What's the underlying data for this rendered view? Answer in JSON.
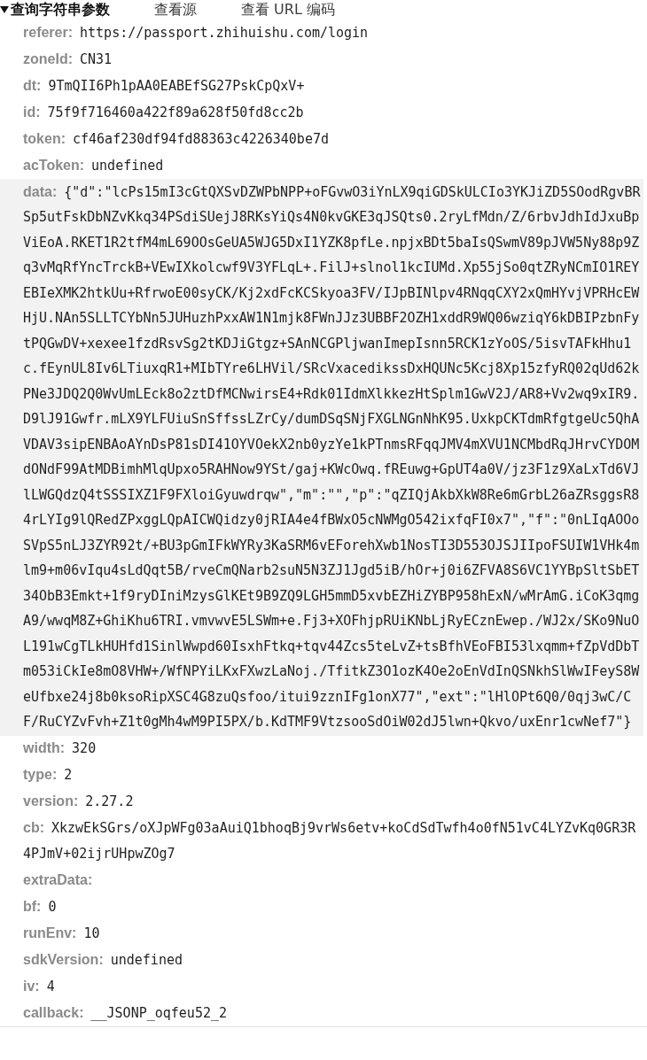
{
  "section": {
    "title": "查询字符串参数",
    "expanded": true,
    "actions": [
      "查看源",
      "查看 URL 编码"
    ]
  },
  "params": [
    {
      "name": "referer:",
      "value": "https://passport.zhihuishu.com/login",
      "selected": false
    },
    {
      "name": "zoneId:",
      "value": "CN31",
      "selected": false
    },
    {
      "name": "dt:",
      "value": "9TmQII6Ph1pAA0EABEfSG27PskCpQxV+",
      "selected": false
    },
    {
      "name": "id:",
      "value": "75f9f716460a422f89a628f50fd8cc2b",
      "selected": false
    },
    {
      "name": "token:",
      "value": "cf46af230df94fd88363c4226340be7d",
      "selected": false
    },
    {
      "name": "acToken:",
      "value": "undefined",
      "selected": false
    },
    {
      "name": "data:",
      "value": "{\"d\":\"lcPs15mI3cGtQXSvDZWPbNPP+oFGvwO3iYnLX9qiGDSkULCIo3YKJiZD5SOodRgvBRSp5utFskDbNZvKkq34PSdiSUejJ8RKsYiQs4N0kvGKE3qJSQts0.2ryLfMdn/Z/6rbvJdhIdJxuBpViEoA.RKET1R2tfM4mL69OOsGeUA5WJG5DxI1YZK8pfLe.npjxBDt5baIsQSwmV89pJVW5Ny88p9Zq3vMqRfYncTrckB+VEwIXkolcwf9V3YFLqL+.FilJ+slnol1kcIUMd.Xp55jSo0qtZRyNCmIO1REYEBIeXMK2htkUu+RfrwoE00syCK/Kj2xdFcKCSkyoa3FV/IJpBINlpv4RNqqCXY2xQmHYvjVPRHcEWHjU.NAn5SLLTCYbNn5JUHuzhPxxAW1N1mjk8FWnJJz3UBBF2OZH1xddR9WQ06wziqY6kDBIPzbnFytPQGwDV+xexee1fzdRsvSg2tKDJiGtgz+SAnNCGPljwanImepIsnn5RCK1zYoOS/5isvTAFkHhu1c.fEynUL8Iv6LTiuxqR1+MIbTYre6LHVil/SRcVxacedikssDxHQUNc5Kcj8Xp15zfyRQ02qUd62kPNe3JDQ2Q0WvUmLEck8o2ztDfMCNwirsE4+Rdk01IdmXlkkezHtSplm1GwV2J/AR8+Vv2wq9xIR9.D9lJ91Gwfr.mLX9YLFUiuSnSffssLZrCy/dumDSqSNjFXGLNGnNhK95.UxkpCKTdmRfgtgeUc5QhAVDAV3sipENBAoAYnDsP81sDI41OYVOekX2nb0yzYe1kPTnmsRFqqJMV4mXVU1NCMbdRqJHrvCYDOMdONdF99AtMDBimhMlqUpxo5RAHNow9YSt/gaj+KWcOwq.fREuwg+GpUT4a0V/jz3F1z9XaLxTd6VJlLWGQdzQ4tSSSIXZ1F9FXloiGyuwdrqw\",\"m\":\"\",\"p\":\"qZIQjAkbXkW8Re6mGrbL26aZRsggsR84rLYIg9lQRedZPxggLQpAICWQidzy0jRIA4e4fBWxO5cNWMgO542ixfqFI0x7\",\"f\":\"0nLIqAOOoSVpS5nLJ3ZYR92t/+BU3pGmIFkWYRy3KaSRM6vEForehXwb1NosTI3D553OJSJIIpoFSUIW1VHk4mlm9+m06vIqu4sLdQqt5B/rveCmQNarb2suN5N3ZJ1Jgd5iB/hOr+j0i6ZFVA8S6VC1YYBpSltSbET34ObB3Emkt+1f9ryDIniMzysGlKEt9B9ZQ9LGH5mmD5xvbEZHiZYBP958hExN/wMrAmG.iCoK3qmgA9/wwqM8Z+GhiKhu6TRI.vmvwvE5LSWm+e.Fj3+XOFhjpRUiKNbLjRyECznEwep./WJ2x/SKo9NuOL191wCgTLkHUHfd1SinlWwpd60IsxhFtkq+tqv44Zcs5teLvZ+tsBfhVEoFBI53lxqmm+fZpVdDbTm053iCkIe8mO8VHW+/WfNPYiLKxFXwzLaNoj./TfitkZ3O1ozK4Oe2oEnVdInQSNkhSlWwIFeyS8WeUfbxe24j8b0ksoRipXSC4G8zuQsfoo/itui9zznIFg1onX77\",\"ext\":\"lHlOPt6Q0/0qj3wC/CF/RuCYZvFvh+Z1t0gMh4wM9PI5PX/b.KdTMF9VtzsooSdOiW02dJ5lwn+Qkvo/uxEnr1cwNef7\"}",
      "selected": true
    },
    {
      "name": "width:",
      "value": "320",
      "selected": false
    },
    {
      "name": "type:",
      "value": "2",
      "selected": false
    },
    {
      "name": "version:",
      "value": "2.27.2",
      "selected": false
    },
    {
      "name": "cb:",
      "value": "XkzwEkSGrs/oXJpWFg03aAuiQ1bhoqBj9vrWs6etv+koCdSdTwfh4o0fN51vC4LYZvKq0GR3R4PJmV+02ijrUHpwZOg7",
      "selected": false
    },
    {
      "name": "extraData:",
      "selected": false
    },
    {
      "name": "bf:",
      "value": "0",
      "selected": false
    },
    {
      "name": "runEnv:",
      "value": "10",
      "selected": false
    },
    {
      "name": "sdkVersion:",
      "value": "undefined",
      "selected": false
    },
    {
      "name": "iv:",
      "value": "4",
      "selected": false
    },
    {
      "name": "callback:",
      "value": "__JSONP_oqfeu52_2",
      "selected": false
    }
  ]
}
